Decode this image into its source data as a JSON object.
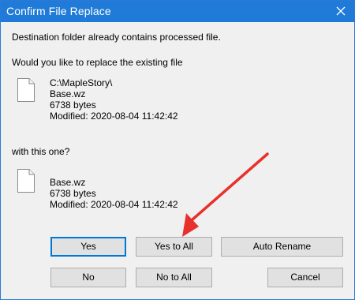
{
  "window": {
    "title": "Confirm File Replace",
    "close_label": "✕"
  },
  "message": {
    "line1": "Destination folder already contains processed file.",
    "line2": "Would you like to replace the existing file",
    "line3": "with this one?"
  },
  "existing_file": {
    "path": "C:\\MapleStory\\",
    "name": "Base.wz",
    "size": "6738 bytes",
    "modified": "Modified: 2020-08-04 11:42:42"
  },
  "new_file": {
    "name": "Base.wz",
    "size": "6738 bytes",
    "modified": "Modified: 2020-08-04 11:42:42"
  },
  "buttons": {
    "yes": "Yes",
    "yes_to_all": "Yes to All",
    "auto_rename": "Auto Rename",
    "no": "No",
    "no_to_all": "No to All",
    "cancel": "Cancel"
  },
  "annotation": {
    "arrow_color": "#e8302c",
    "points_to": "yes-to-all-button"
  },
  "colors": {
    "titlebar": "#1f7bd7",
    "dialog_bg": "#f0f0f0",
    "button_bg": "#e1e1e1",
    "focus_border": "#0078d7"
  }
}
